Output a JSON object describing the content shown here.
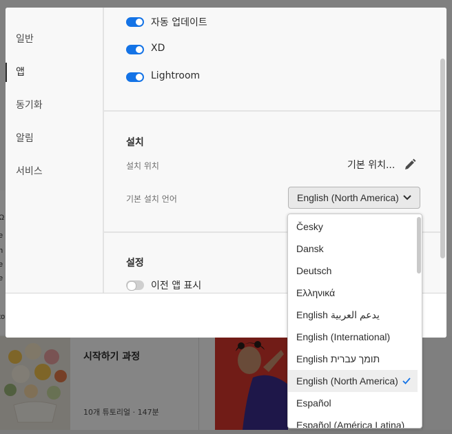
{
  "background": {
    "card_title": "시작하기 과정",
    "card_meta": "10개 튜토리얼 · 147분",
    "left_edge_text": [
      "Ω",
      "e",
      "h",
      "e",
      "e",
      "to"
    ]
  },
  "dialog": {
    "sidebar": {
      "items": [
        {
          "label": "일반",
          "active": false
        },
        {
          "label": "앱",
          "active": true
        },
        {
          "label": "동기화",
          "active": false
        },
        {
          "label": "알림",
          "active": false
        },
        {
          "label": "서비스",
          "active": false
        }
      ]
    },
    "updates": {
      "toggles": [
        {
          "label": "자동 업데이트",
          "on": true
        },
        {
          "label": "XD",
          "on": true
        },
        {
          "label": "Lightroom",
          "on": true
        }
      ]
    },
    "install": {
      "title": "설치",
      "location_label": "설치 위치",
      "location_value": "기본 위치...",
      "language_label": "기본 설치 언어",
      "language_selected": "English (North America)"
    },
    "settings": {
      "title": "설정",
      "show_previous_label": "이전 앱 표시",
      "show_previous_on": false
    }
  },
  "dropdown": {
    "options": [
      "Česky",
      "Dansk",
      "Deutsch",
      "Ελληνικά",
      "English يدعم العربية",
      "English (International)",
      "English תומך עברית",
      "English (North America)",
      "Español",
      "Español (América Latina)"
    ],
    "selected_index": 7
  },
  "colors": {
    "accent": "#1473e6",
    "dialog_bg": "#f8f8f8",
    "overlay": "rgba(0,0,0,0.48)"
  }
}
